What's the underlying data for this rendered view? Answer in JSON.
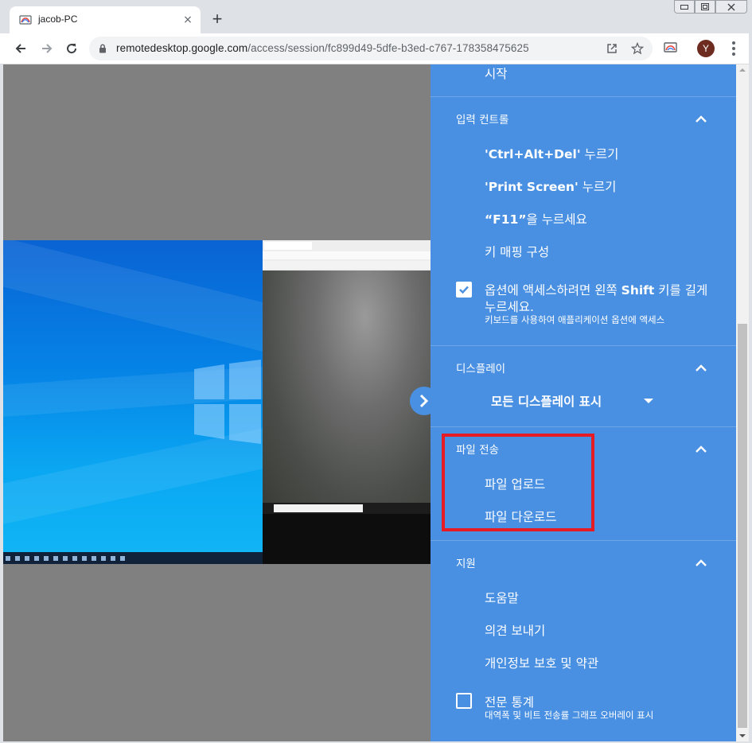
{
  "browser": {
    "tab_title": "jacob-PC",
    "tab_close": "×",
    "new_tab": "+",
    "url_host": "remotedesktop.google.com",
    "url_path": "/access/session/fc899d49-5dfe-b3ed-c767-178358475625",
    "avatar_letter": "Y",
    "window_min": "▭",
    "window_max": "▣",
    "window_close": "✕"
  },
  "panel": {
    "start_item": "시작",
    "input_section": {
      "title": "입력 컨트롤",
      "items": [
        {
          "bold": "'Ctrl+Alt+Del'",
          "rest": " 누르기"
        },
        {
          "bold": "'Print Screen'",
          "rest": " 누르기"
        },
        {
          "bold": "“F11”",
          "rest": "을 누르세요"
        },
        {
          "bold": "",
          "rest": "키 매핑 구성"
        }
      ],
      "shift_option": {
        "checked": true,
        "line1_pre": "옵션에 액세스하려면 왼쪽 ",
        "line1_bold": "Shift",
        "line1_post": " 키를 길게",
        "line2": "누르세요.",
        "subtext": "키보드를 사용하여 애플리케이션 옵션에 액세스"
      }
    },
    "display_section": {
      "title": "디스플레이",
      "selected": "모든 디스플레이 표시"
    },
    "file_section": {
      "title": "파일 전송",
      "upload": "파일 업로드",
      "download": "파일 다운로드"
    },
    "support_section": {
      "title": "지원",
      "help": "도움말",
      "feedback": "의견 보내기",
      "privacy": "개인정보 보호 및 약관"
    },
    "stats": {
      "checked": false,
      "label": "전문 통계",
      "subtext": "대역폭 및 비트 전송률 그래프 오버레이 표시"
    }
  },
  "colors": {
    "panel_bg": "#4a90e2",
    "highlight": "#e61b23",
    "viewport_bg": "#808080"
  },
  "icons": [
    "browser-favicon",
    "back-icon",
    "forward-icon",
    "reload-icon",
    "lock-icon",
    "open-in-new-icon",
    "star-icon",
    "cast-icon",
    "more-icon",
    "chevron-up-icon",
    "checkbox-icon",
    "dropdown-caret-icon",
    "chevron-right-icon",
    "windows-logo-icon"
  ]
}
